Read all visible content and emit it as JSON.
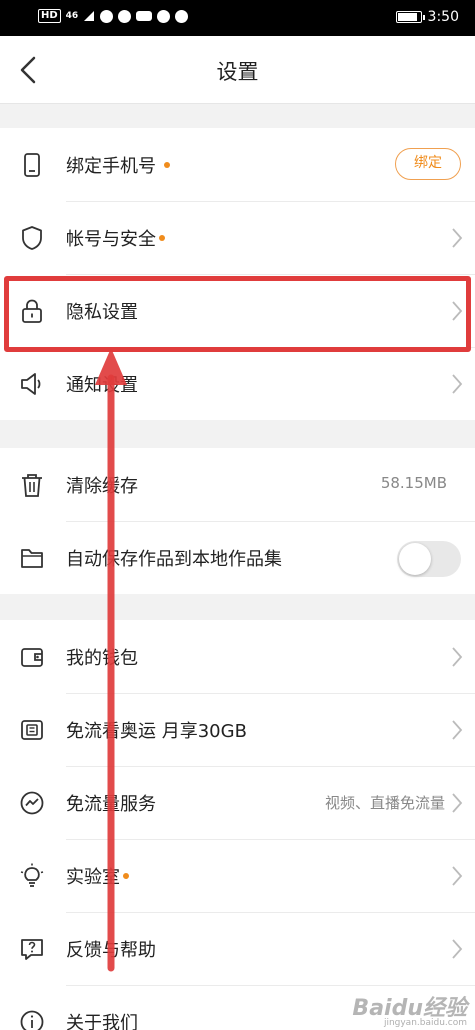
{
  "status_bar": {
    "left_text": "HD",
    "signal": "46",
    "time": "3:50",
    "battery_level": 0.9
  },
  "nav": {
    "title": "设置"
  },
  "section1": [
    {
      "id": "phone",
      "icon": "phone-icon",
      "label": "绑定手机号",
      "dot": true,
      "action": "button",
      "button_label": "绑定"
    },
    {
      "id": "account",
      "icon": "shield-icon",
      "label": "帐号与安全",
      "dot": true,
      "action": "chevron"
    },
    {
      "id": "privacy",
      "icon": "lock-icon",
      "label": "隐私设置",
      "dot": false,
      "action": "chevron"
    },
    {
      "id": "notify",
      "icon": "speaker-icon",
      "label": "通知设置",
      "dot": false,
      "action": "chevron"
    }
  ],
  "section2": [
    {
      "id": "cache",
      "icon": "trash-icon",
      "label": "清除缓存",
      "value": "58.15MB"
    },
    {
      "id": "autosave",
      "icon": "folder-icon",
      "label": "自动保存作品到本地作品集",
      "toggle_on": false
    }
  ],
  "section3": [
    {
      "id": "wallet",
      "icon": "wallet-icon",
      "label": "我的钱包",
      "dot": false
    },
    {
      "id": "olympics",
      "icon": "card-icon",
      "label": "免流看奥运 月享30GB",
      "dot": false
    },
    {
      "id": "freeflow",
      "icon": "trend-icon",
      "label": "免流量服务",
      "dot": false,
      "value": "视频、直播免流量"
    },
    {
      "id": "lab",
      "icon": "bulb-icon",
      "label": "实验室",
      "dot": true
    },
    {
      "id": "feedback",
      "icon": "help-icon",
      "label": "反馈与帮助",
      "dot": false
    },
    {
      "id": "about",
      "icon": "info-icon",
      "label": "关于我们",
      "dot": false
    }
  ],
  "annotation": {
    "highlight_color": "#e03c3c",
    "target": "隐私设置"
  },
  "watermark": {
    "text": "Baidu经验",
    "sub": "jingyan.baidu.com"
  },
  "colors": {
    "accent": "#f08c1c",
    "background": "#f2f2f2"
  }
}
